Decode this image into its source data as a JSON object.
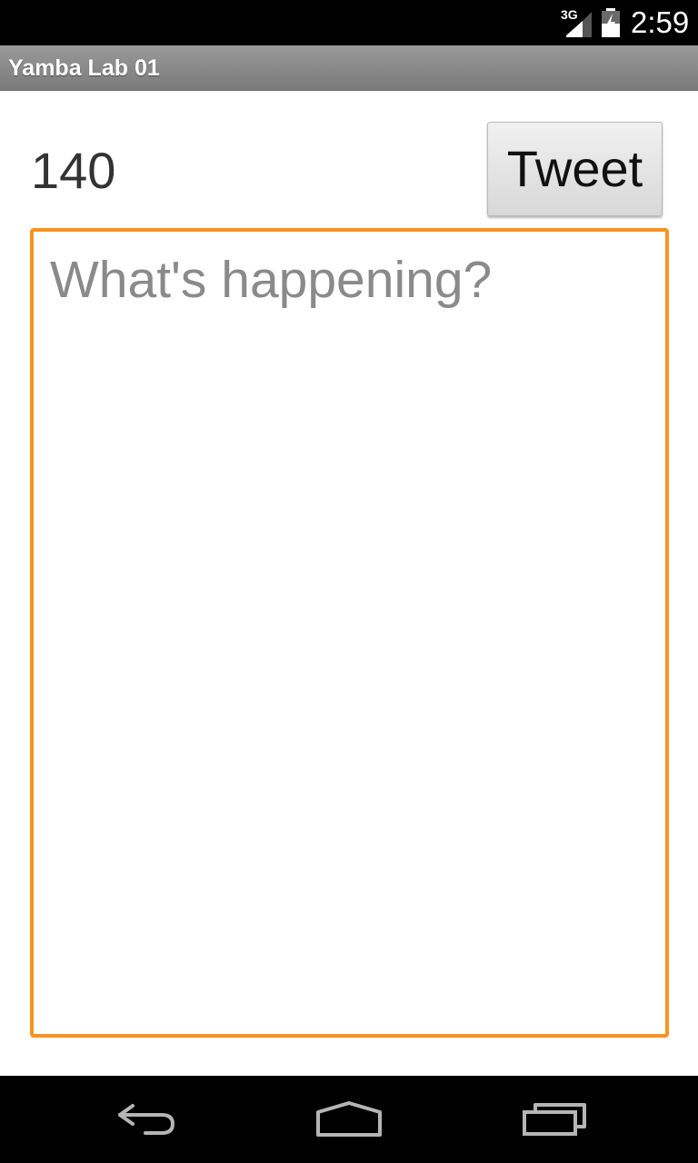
{
  "status_bar": {
    "network": "3G",
    "time": "2:59",
    "icons": [
      "signal-icon",
      "battery-charging-icon"
    ]
  },
  "app": {
    "title": "Yamba Lab 01"
  },
  "compose": {
    "counter": "140",
    "tweet_button_label": "Tweet",
    "status_placeholder": "What's happening?",
    "status_value": ""
  },
  "nav_bar": {
    "icons": [
      "back-icon",
      "home-icon",
      "recent-apps-icon"
    ]
  },
  "colors": {
    "input_border": "#f7931e",
    "action_bar": "#8c8c8c",
    "status_bar": "#000000",
    "nav_bar": "#000000"
  }
}
